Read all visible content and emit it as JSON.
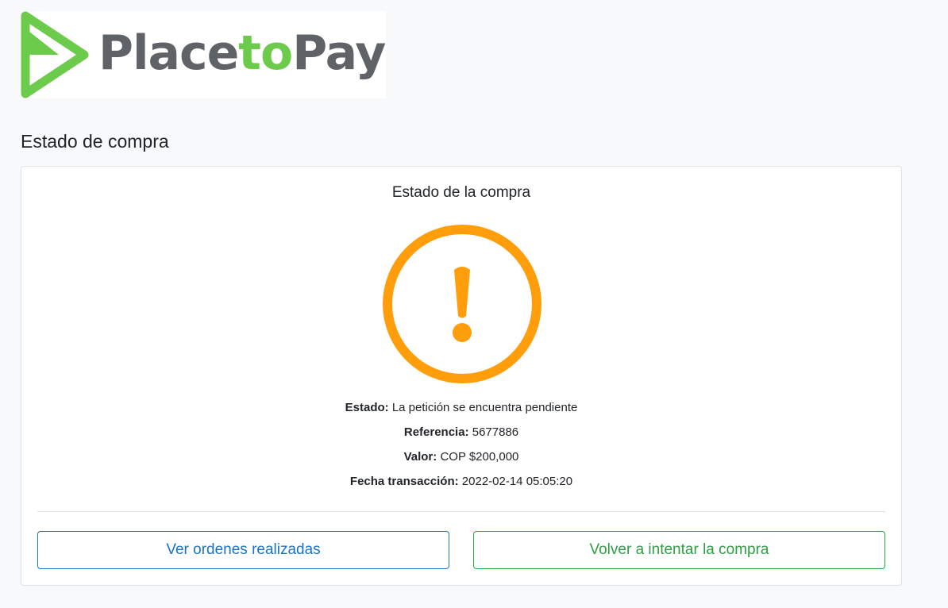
{
  "brand": {
    "part1": "Place",
    "part2": "to",
    "part3": "Pay",
    "logo_icon": "play-arrow-icon",
    "gray": "#5f6266",
    "green": "#6ccb4b"
  },
  "page": {
    "title": "Estado de compra"
  },
  "card": {
    "title": "Estado de la compra",
    "status_icon": "warning-exclamation-icon",
    "status_color": "#ff9d0a",
    "rows": [
      {
        "label": "Estado:",
        "value": "La petición se encuentra pendiente"
      },
      {
        "label": "Referencia:",
        "value": "5677886"
      },
      {
        "label": "Valor:",
        "value": "COP $200,000"
      },
      {
        "label": "Fecha transacción:",
        "value": "2022-02-14 05:05:20"
      }
    ]
  },
  "actions": {
    "orders_label": "Ver ordenes realizadas",
    "retry_label": "Volver a intentar la compra"
  }
}
